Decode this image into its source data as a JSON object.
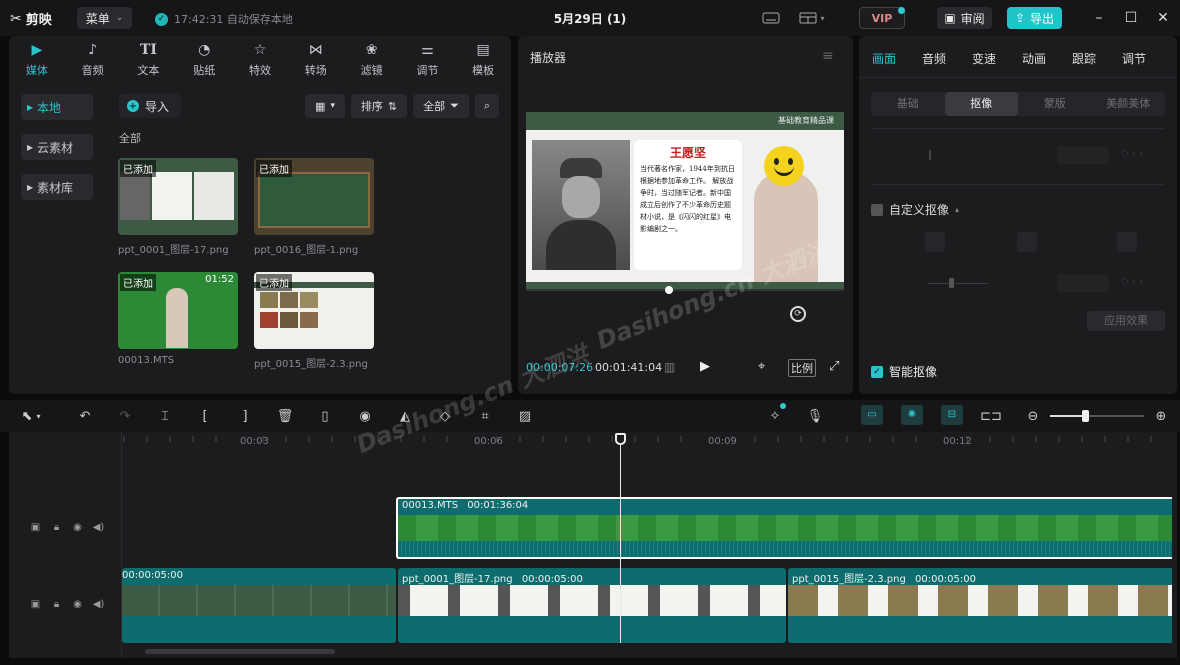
{
  "topbar": {
    "app_name": "剪映",
    "menu_label": "菜单",
    "autosave_text": "17:42:31 自动保存本地",
    "doc_title": "5月29日 (1)",
    "vip_label": "VIP",
    "review_label": "审阅",
    "export_label": "导出"
  },
  "media": {
    "tabs": [
      {
        "label": "媒体",
        "icon": "media-icon"
      },
      {
        "label": "音频",
        "icon": "audio-icon"
      },
      {
        "label": "文本",
        "icon": "text-icon"
      },
      {
        "label": "贴纸",
        "icon": "sticker-icon"
      },
      {
        "label": "特效",
        "icon": "effects-icon"
      },
      {
        "label": "转场",
        "icon": "transition-icon"
      },
      {
        "label": "滤镜",
        "icon": "filter-icon"
      },
      {
        "label": "调节",
        "icon": "adjust-icon"
      },
      {
        "label": "模板",
        "icon": "template-icon"
      }
    ],
    "side_nav": [
      {
        "label": "本地"
      },
      {
        "label": "云素材"
      },
      {
        "label": "素材库"
      }
    ],
    "import_label": "导入",
    "sort_label": "排序",
    "filter_label": "全部",
    "section_label": "全部",
    "items": [
      {
        "badge": "已添加",
        "name": "ppt_0001_图层-17.png",
        "duration": ""
      },
      {
        "badge": "已添加",
        "name": "ppt_0016_图层-1.png",
        "duration": ""
      },
      {
        "badge": "已添加",
        "name": "00013.MTS",
        "duration": "01:52"
      },
      {
        "badge": "已添加",
        "name": "ppt_0015_图层-2.3.png",
        "duration": ""
      }
    ]
  },
  "player": {
    "title": "播放器",
    "current_time": "00:00:07:26",
    "total_time": "00:01:41:04",
    "ratio_label": "比例",
    "slide": {
      "header": "基础教育精品课",
      "name": "王愿坚",
      "text": "当代著名作家，1944年到抗日根据地参加革命工作。 解放战争时，当过随军记者。新中国成立后创作了不少革命历史题材小说，是《闪闪的红星》电影编剧之一。"
    },
    "watermark": "Dasihong.cn 大泗洪"
  },
  "properties": {
    "tabs": [
      {
        "label": "画面"
      },
      {
        "label": "音频"
      },
      {
        "label": "变速"
      },
      {
        "label": "动画"
      },
      {
        "label": "跟踪"
      },
      {
        "label": "调节"
      }
    ],
    "subtabs": [
      {
        "label": "基础"
      },
      {
        "label": "抠像"
      },
      {
        "label": "蒙版"
      },
      {
        "label": "美颜美体"
      }
    ],
    "custom_key_label": "自定义抠像",
    "apply_label": "应用效果",
    "smart_key_label": "智能抠像"
  },
  "timeline": {
    "ruler": [
      "00:03",
      "00:06",
      "00:09",
      "00:12"
    ],
    "video_clip": {
      "name": "00013.MTS",
      "duration": "00:01:36:04"
    },
    "image_clips": [
      {
        "name": "",
        "duration": "00:00:05:00"
      },
      {
        "name": "ppt_0001_图层-17.png",
        "duration": "00:00:05:00"
      },
      {
        "name": "ppt_0015_图层-2.3.png",
        "duration": "00:00:05:00"
      }
    ]
  },
  "colors": {
    "accent": "#29c5cb",
    "clip_teal": "#0d6d6e",
    "green_screen": "#2c8a36"
  }
}
